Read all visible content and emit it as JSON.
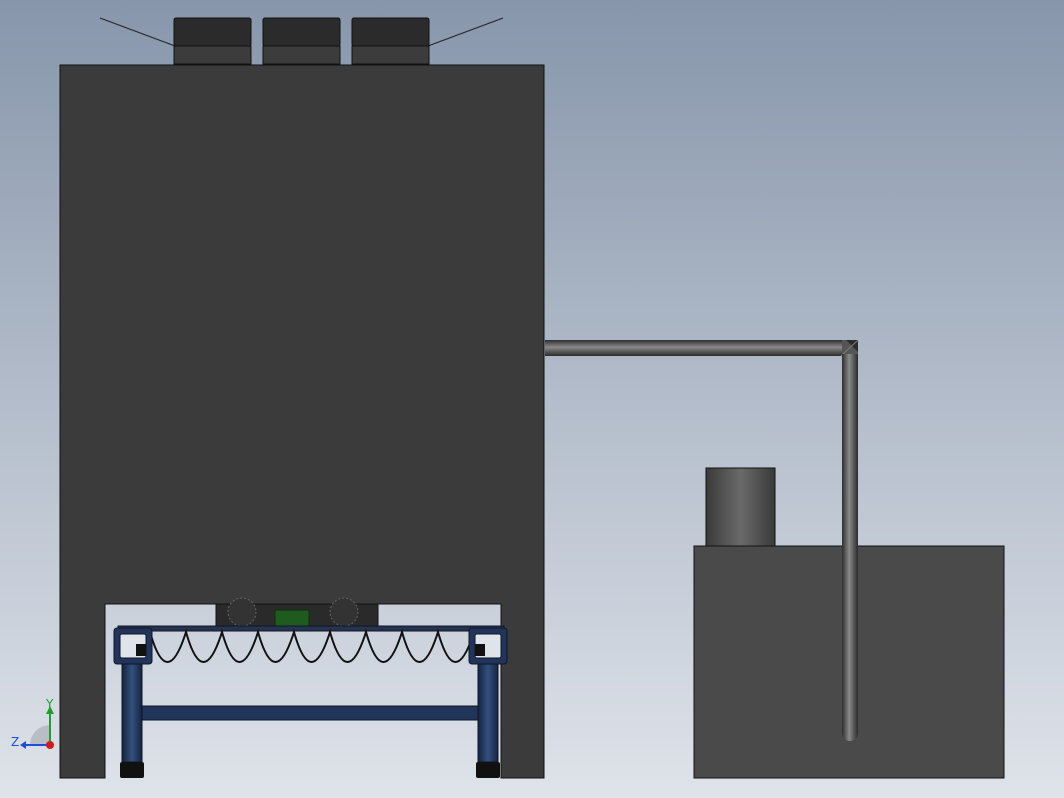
{
  "viewport": {
    "background_top": "#8796ab",
    "background_bottom": "#dfe3ea",
    "model_color": "#3b3b3b",
    "frame_color": "#1e2e4a"
  },
  "triad": {
    "y_label": "Y",
    "z_label": "Z",
    "y_color": "#1ca02c",
    "z_color": "#1d4fd8",
    "x_color": "#d11c1c"
  }
}
